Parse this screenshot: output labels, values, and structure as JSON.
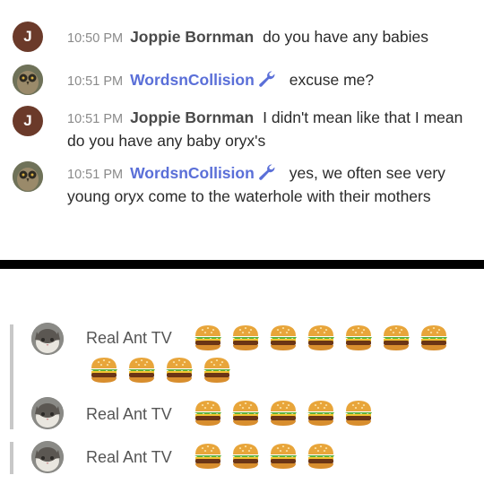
{
  "top_chat": {
    "messages": [
      {
        "time": "10:50 PM",
        "user": "Joppie Bornman",
        "avatar_letter": "J",
        "is_mod": false,
        "text": "do you have any babies"
      },
      {
        "time": "10:51 PM",
        "user": "WordsnCollision",
        "avatar_letter": "",
        "is_mod": true,
        "text": "excuse me?"
      },
      {
        "time": "10:51 PM",
        "user": "Joppie Bornman",
        "avatar_letter": "J",
        "is_mod": false,
        "text": "I didn't mean like that I mean do you have any baby oryx's"
      },
      {
        "time": "10:51 PM",
        "user": "WordsnCollision",
        "avatar_letter": "",
        "is_mod": true,
        "text": "yes, we often see very young oryx come to the waterhole with their mothers"
      }
    ],
    "mod_icon": "wrench-icon",
    "colors": {
      "mod_name": "#5a6fd8",
      "avatar_j": "#6b3a2a",
      "timestamp": "#8a8a8a"
    }
  },
  "bottom_chat": {
    "rows": [
      {
        "user": "Real Ant TV",
        "burger_count": 11
      },
      {
        "user": "Real Ant TV",
        "burger_count": 5
      },
      {
        "user": "Real Ant TV",
        "burger_count": 4
      }
    ],
    "emoji": "hamburger-emoji"
  }
}
